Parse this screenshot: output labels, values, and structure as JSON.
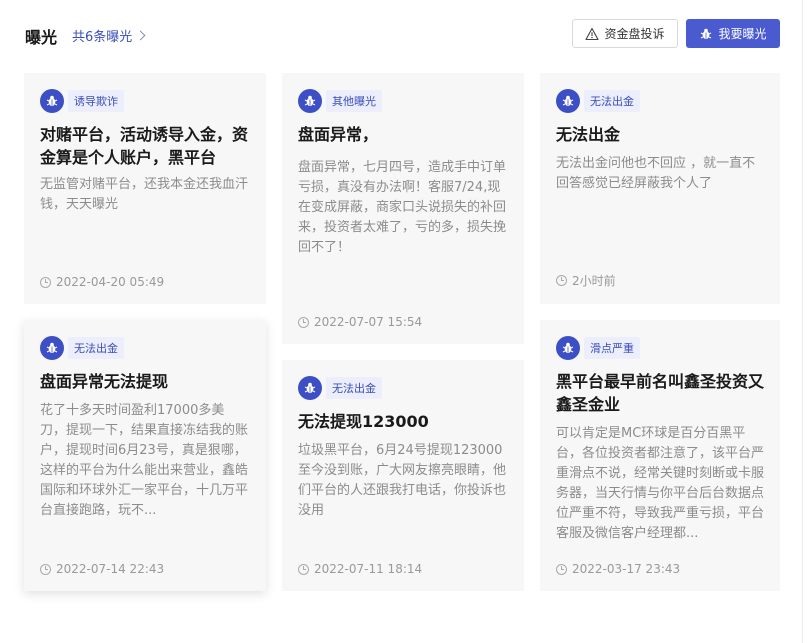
{
  "header": {
    "title": "曝光",
    "count_link": "共6条曝光",
    "complain_button": "资金盘投诉",
    "expose_button": "我要曝光"
  },
  "colors": {
    "accent": "#4a5bd0",
    "tag_bg": "#eceefb",
    "tag_text": "#3a4fb8",
    "card_bg": "#f7f7f8"
  },
  "cards": [
    {
      "tag": "诱导欺诈",
      "title": "对赌平台，活动诱导入金，资金算是个人账户，黑平台无...",
      "body": "无监管对赌平台，还我本金还我血汗钱，天天曝光",
      "time": "2022-04-20 05:49"
    },
    {
      "tag": "其他曝光",
      "title": "盘面异常，",
      "body": "盘面异常，七月四号，造成手中订单亏损，真没有办法啊！客服7/24,现在变成屏蔽，商家口头说损失的补回来，投资者太难了，亏的多，损失挽回不了！",
      "time": "2022-07-07 15:54"
    },
    {
      "tag": "无法出金",
      "title": "无法出金",
      "body": "无法出金问他也不回应 ，就一直不回答感觉已经屏蔽我个人了",
      "time": "2小时前"
    },
    {
      "tag": "无法出金",
      "title": "盘面异常无法提现",
      "body": "花了十多天时间盈利17000多美刀，提现一下，结果直接冻结我的账户，提现时间6月23号，真是狠哪，这样的平台为什么能出来营业，鑫皓国际和环球外汇一家平台，十几万平台直接跑路，玩不...",
      "time": "2022-07-14 22:43"
    },
    {
      "tag": "无法出金",
      "title": "无法提现123000",
      "body": "垃圾黑平台，6月24号提现123000至今没到账，广大网友擦亮眼睛，他们平台的人还跟我打电话，你投诉也没用",
      "time": "2022-07-11 18:14"
    },
    {
      "tag": "滑点严重",
      "title": "黑平台最早前名叫鑫圣投资又鑫圣金业",
      "body": "可以肯定是MC环球是百分百黑平台，各位投资者都注意了，该平台严重滑点不说，经常关键时刻断或卡服务器，当天行情与你平台后台数据点位严重不符，导致我严重亏损，平台客服及微信客户经理都...",
      "time": "2022-03-17 23:43"
    }
  ]
}
